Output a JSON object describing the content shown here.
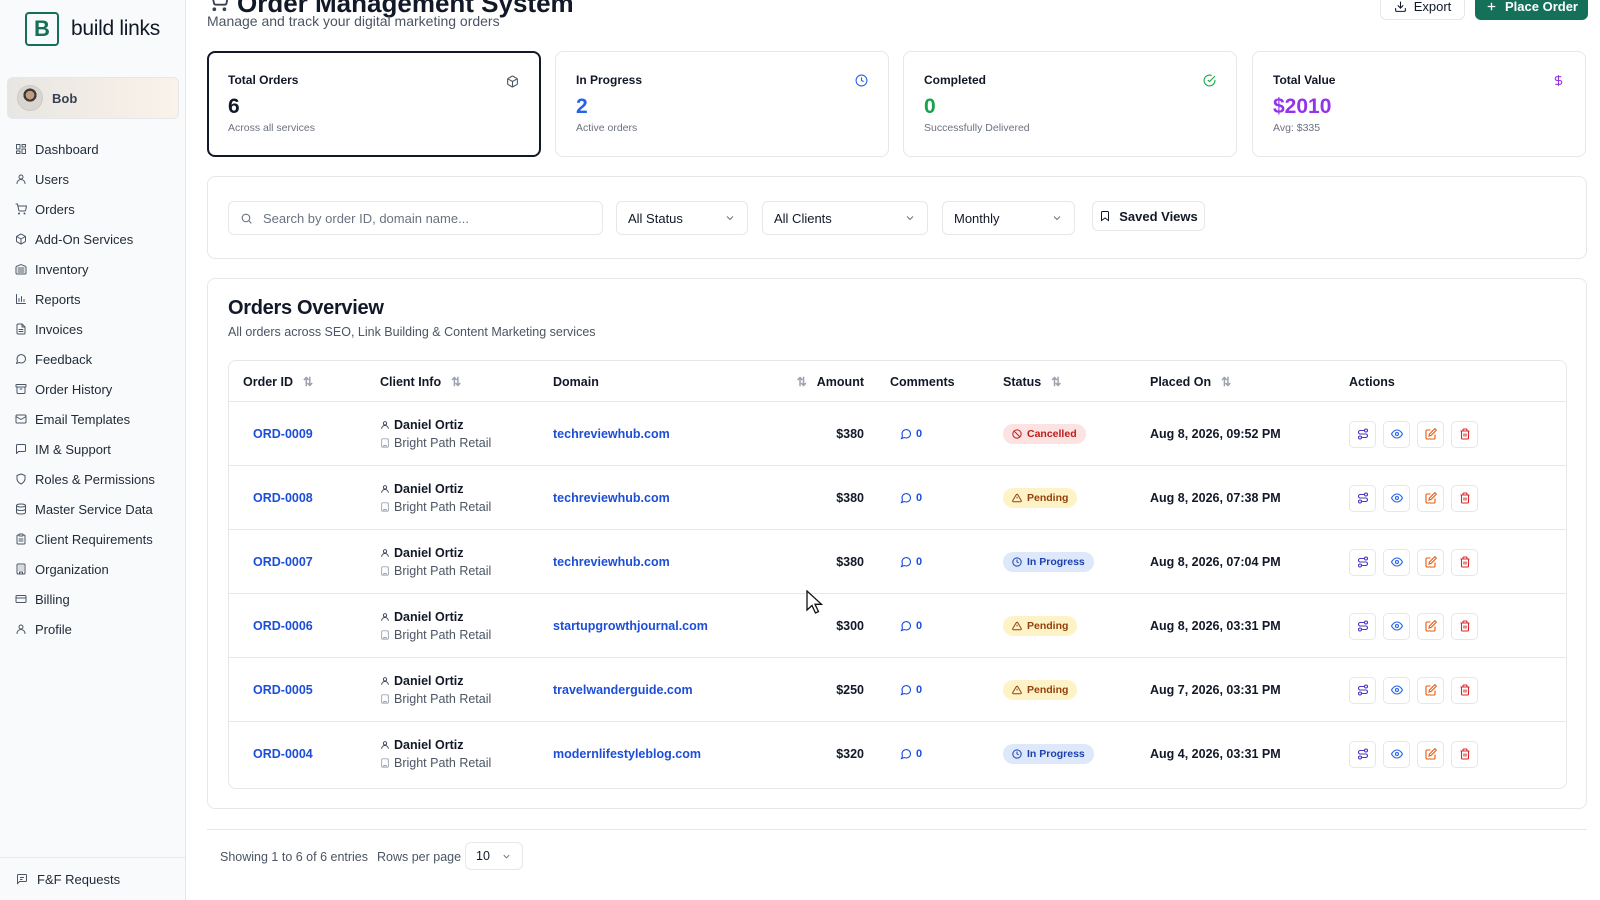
{
  "brand": {
    "logo_letter": "B",
    "name": "build links",
    "accent": "#15705a"
  },
  "user": {
    "name": "Bob"
  },
  "nav": [
    {
      "label": "Dashboard",
      "icon": "dashboard-icon"
    },
    {
      "label": "Users",
      "icon": "user-icon"
    },
    {
      "label": "Orders",
      "icon": "cart-icon"
    },
    {
      "label": "Add-On Services",
      "icon": "package-icon"
    },
    {
      "label": "Inventory",
      "icon": "warehouse-icon"
    },
    {
      "label": "Reports",
      "icon": "bar-chart-icon"
    },
    {
      "label": "Invoices",
      "icon": "file-icon"
    },
    {
      "label": "Feedback",
      "icon": "message-circle-icon"
    },
    {
      "label": "Order History",
      "icon": "archive-icon"
    },
    {
      "label": "Email Templates",
      "icon": "mail-icon"
    },
    {
      "label": "IM & Support",
      "icon": "message-square-icon"
    },
    {
      "label": "Roles & Permissions",
      "icon": "shield-icon"
    },
    {
      "label": "Master Service Data",
      "icon": "database-icon"
    },
    {
      "label": "Client Requirements",
      "icon": "clipboard-icon"
    },
    {
      "label": "Organization",
      "icon": "building-icon"
    },
    {
      "label": "Billing",
      "icon": "credit-card-icon"
    },
    {
      "label": "Profile",
      "icon": "user-icon"
    }
  ],
  "sidebar_footer": {
    "label": "F&F Requests",
    "icon": "message-lines-icon"
  },
  "header": {
    "title": "Order Management System",
    "subtitle": "Manage and track your digital marketing orders",
    "export_label": "Export",
    "place_order_label": "Place Order"
  },
  "stats": [
    {
      "label": "Total Orders",
      "value": "6",
      "sub": "Across all services",
      "icon": "package-icon",
      "color": "#111827"
    },
    {
      "label": "In Progress",
      "value": "2",
      "sub": "Active orders",
      "icon": "clock-icon",
      "color": "#2563eb"
    },
    {
      "label": "Completed",
      "value": "0",
      "sub": "Successfully Delivered",
      "icon": "check-circle-icon",
      "color": "#16a34a"
    },
    {
      "label": "Total Value",
      "value": "$2010",
      "sub": "Avg: $335",
      "icon": "dollar-icon",
      "color": "#9333ea"
    }
  ],
  "filters": {
    "search_placeholder": "Search by order ID, domain name...",
    "status": "All Status",
    "clients": "All Clients",
    "period": "Monthly",
    "saved_views": "Saved Views"
  },
  "orders": {
    "title": "Orders Overview",
    "subtitle": "All orders across SEO, Link Building & Content Marketing services",
    "columns": [
      "Order ID",
      "Client Info",
      "Domain",
      "Amount",
      "Comments",
      "Status",
      "Placed On",
      "Actions"
    ],
    "rows": [
      {
        "id": "ORD-0009",
        "client": "Daniel Ortiz",
        "org": "Bright Path Retail",
        "domain": "techreviewhub.com",
        "amount": "$380",
        "comments": "0",
        "status": "Cancelled",
        "status_type": "cancelled",
        "placed": "Aug 8, 2026, 09:52 PM"
      },
      {
        "id": "ORD-0008",
        "client": "Daniel Ortiz",
        "org": "Bright Path Retail",
        "domain": "techreviewhub.com",
        "amount": "$380",
        "comments": "0",
        "status": "Pending",
        "status_type": "pending",
        "placed": "Aug 8, 2026, 07:38 PM"
      },
      {
        "id": "ORD-0007",
        "client": "Daniel Ortiz",
        "org": "Bright Path Retail",
        "domain": "techreviewhub.com",
        "amount": "$380",
        "comments": "0",
        "status": "In Progress",
        "status_type": "inprogress",
        "placed": "Aug 8, 2026, 07:04 PM"
      },
      {
        "id": "ORD-0006",
        "client": "Daniel Ortiz",
        "org": "Bright Path Retail",
        "domain": "startupgrowthjournal.com",
        "amount": "$300",
        "comments": "0",
        "status": "Pending",
        "status_type": "pending",
        "placed": "Aug 8, 2026, 03:31 PM"
      },
      {
        "id": "ORD-0005",
        "client": "Daniel Ortiz",
        "org": "Bright Path Retail",
        "domain": "travelwanderguide.com",
        "amount": "$250",
        "comments": "0",
        "status": "Pending",
        "status_type": "pending",
        "placed": "Aug 7, 2026, 03:31 PM"
      },
      {
        "id": "ORD-0004",
        "client": "Daniel Ortiz",
        "org": "Bright Path Retail",
        "domain": "modernlifestyleblog.com",
        "amount": "$320",
        "comments": "0",
        "status": "In Progress",
        "status_type": "inprogress",
        "placed": "Aug 4, 2026, 03:31 PM"
      }
    ]
  },
  "footer": {
    "showing": "Showing 1 to 6 of 6 entries",
    "rows_per_page_label": "Rows per page",
    "rows_per_page": "10"
  }
}
